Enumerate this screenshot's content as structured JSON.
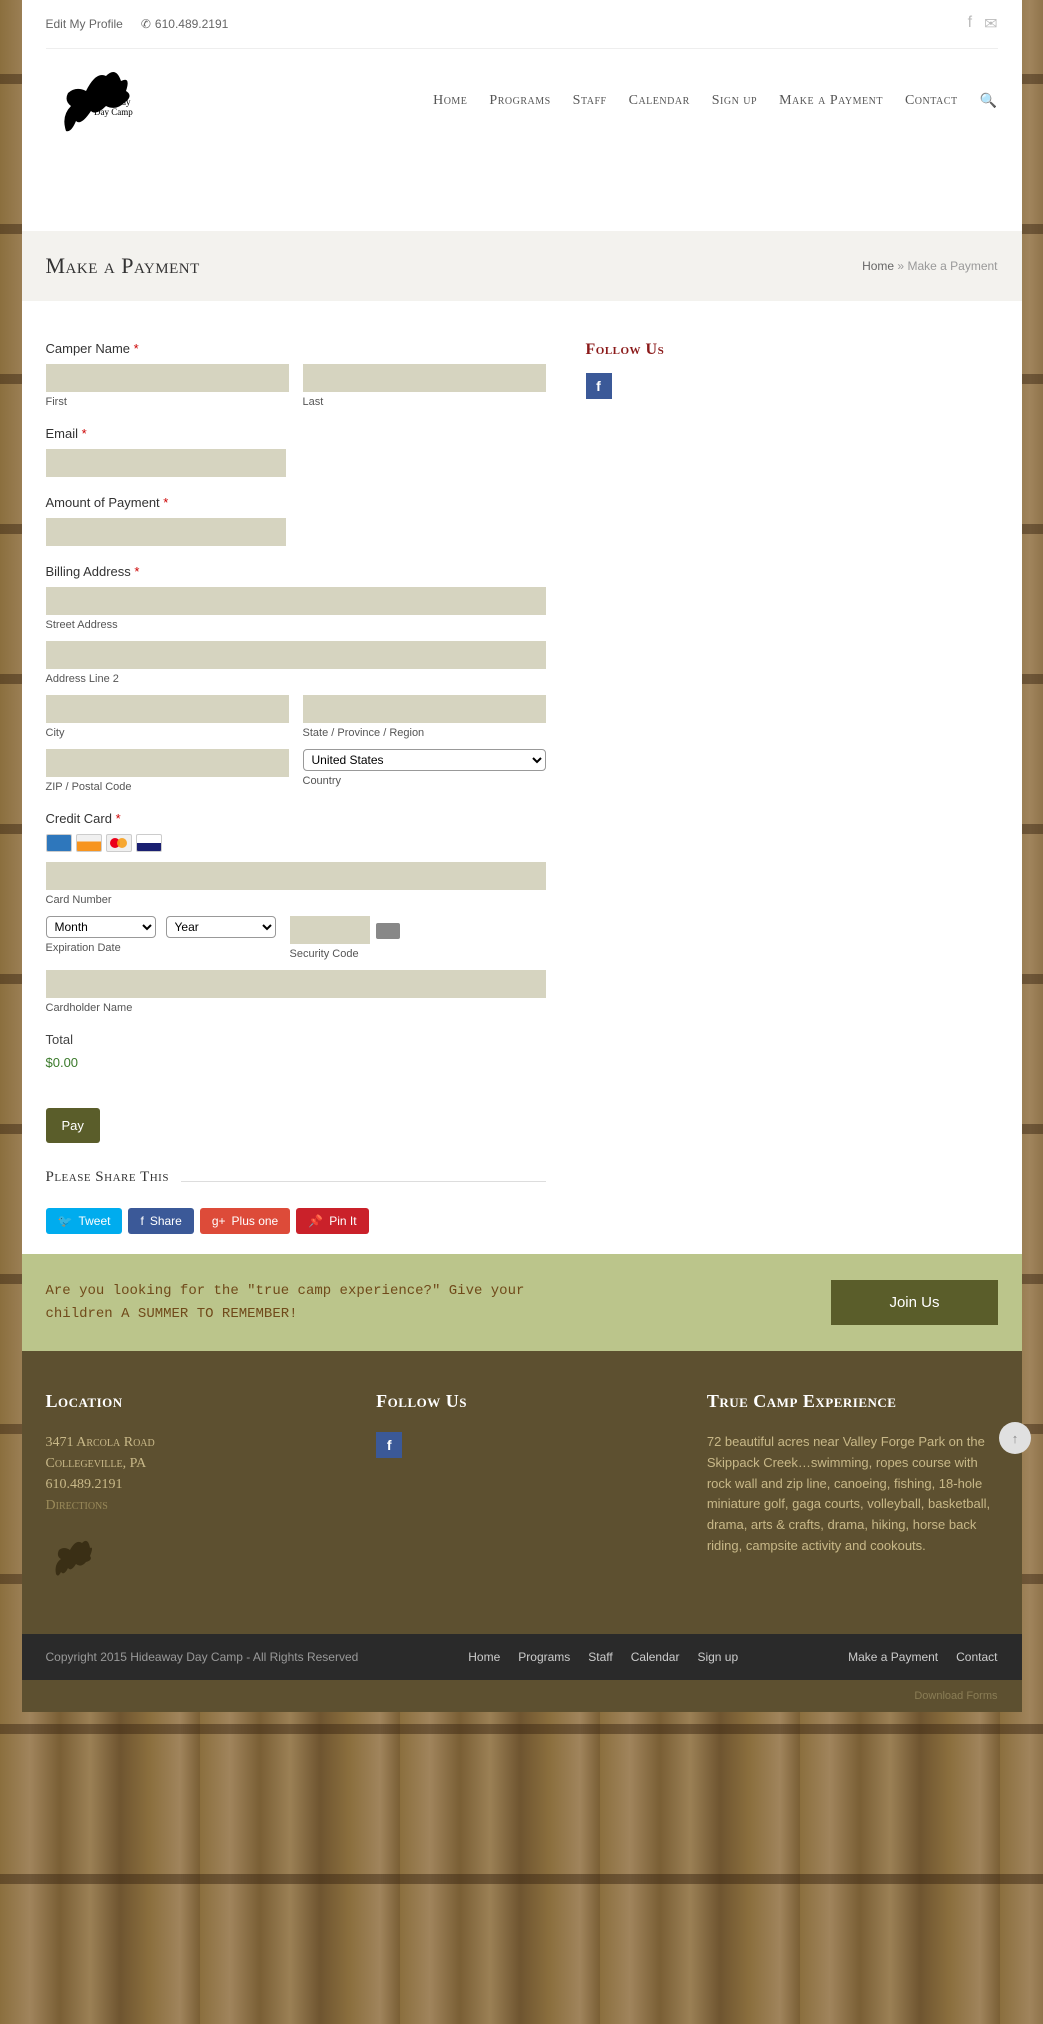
{
  "topbar": {
    "edit_profile": "Edit My Profile",
    "phone": "610.489.2191"
  },
  "nav": {
    "items": [
      "Home",
      "Programs",
      "Staff",
      "Calendar",
      "Sign up",
      "Make a Payment",
      "Contact"
    ]
  },
  "page": {
    "title": "Make a Payment",
    "breadcrumb_home": "Home",
    "breadcrumb_sep": "»",
    "breadcrumb_current": "Make a Payment"
  },
  "sidebar": {
    "follow_us": "Follow Us"
  },
  "form": {
    "camper_name_label": "Camper Name",
    "first": "First",
    "last": "Last",
    "email_label": "Email",
    "amount_label": "Amount of Payment",
    "billing_label": "Billing Address",
    "street": "Street Address",
    "line2": "Address Line 2",
    "city": "City",
    "state": "State / Province / Region",
    "zip": "ZIP / Postal Code",
    "country": "Country",
    "country_selected": "United States",
    "cc_label": "Credit Card",
    "card_number": "Card Number",
    "month": "Month",
    "year": "Year",
    "exp_date": "Expiration Date",
    "sec_code": "Security Code",
    "cardholder": "Cardholder Name",
    "total_label": "Total",
    "total_value": "$0.00",
    "pay": "Pay"
  },
  "share": {
    "title": "Please Share This",
    "tweet": "Tweet",
    "share": "Share",
    "plusone": "Plus one",
    "pinit": "Pin It"
  },
  "cta": {
    "text": "Are you looking for the \"true camp experience?\" Give your children A SUMMER TO REMEMBER!",
    "button": "Join Us"
  },
  "footer": {
    "location_title": "Location",
    "addr1": "3471 Arcola Road",
    "addr2": "Collegeville, PA",
    "phone": "610.489.2191",
    "directions": "Directions",
    "follow_title": "Follow Us",
    "exp_title": "True Camp Experience",
    "exp_text": "72 beautiful acres near Valley Forge Park on the Skippack Creek…swimming, ropes course with rock wall and zip line, canoeing, fishing, 18-hole miniature golf, gaga courts, volleyball, basketball, drama, arts & crafts, drama, hiking, horse back riding, campsite activity and cookouts."
  },
  "bottom": {
    "copyright": "Copyright 2015 Hideaway Day Camp - All Rights Reserved",
    "links": [
      "Home",
      "Programs",
      "Staff",
      "Calendar",
      "Sign up"
    ],
    "links2": [
      "Make a Payment",
      "Contact"
    ],
    "download": "Download Forms"
  }
}
